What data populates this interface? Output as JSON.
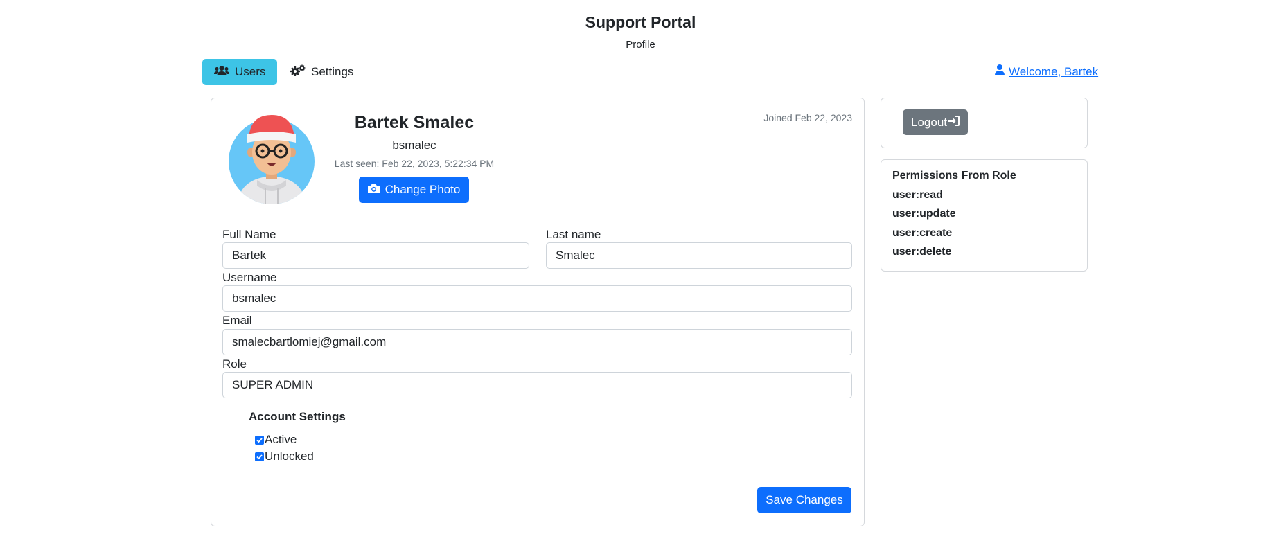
{
  "header": {
    "title": "Support Portal",
    "subtitle": "Profile"
  },
  "nav": {
    "tabs": [
      {
        "label": "Users",
        "icon": "users-icon",
        "active": true
      },
      {
        "label": "Settings",
        "icon": "gears-icon",
        "active": false
      }
    ],
    "welcome_label": " Welcome, Bartek"
  },
  "profile": {
    "full_name": "Bartek Smalec",
    "username": "bsmalec",
    "last_seen": "Last seen: Feb 22, 2023, 5:22:34 PM",
    "joined": "Joined Feb 22, 2023",
    "change_photo_label": "Change Photo"
  },
  "form": {
    "first_name": {
      "label": "Full Name",
      "value": "Bartek"
    },
    "last_name": {
      "label": "Last name",
      "value": "Smalec"
    },
    "username": {
      "label": "Username",
      "value": "bsmalec"
    },
    "email": {
      "label": "Email",
      "value": "smalecbartlomiej@gmail.com"
    },
    "role": {
      "label": "Role",
      "value": "SUPER ADMIN"
    },
    "account_settings": {
      "title": "Account Settings",
      "active": {
        "label": "Active",
        "checked": true
      },
      "unlocked": {
        "label": "Unlocked",
        "checked": true
      }
    },
    "save_label": "Save Changes"
  },
  "sidebar": {
    "logout_label": "Logout",
    "permissions_title": "Permissions From Role",
    "permissions": [
      "user:read",
      "user:update",
      "user:create",
      "user:delete"
    ]
  },
  "colors": {
    "primary": "#0d6efd",
    "info": "#3dc4e6",
    "secondary": "#6c757d",
    "border": "#d5d8dc"
  }
}
